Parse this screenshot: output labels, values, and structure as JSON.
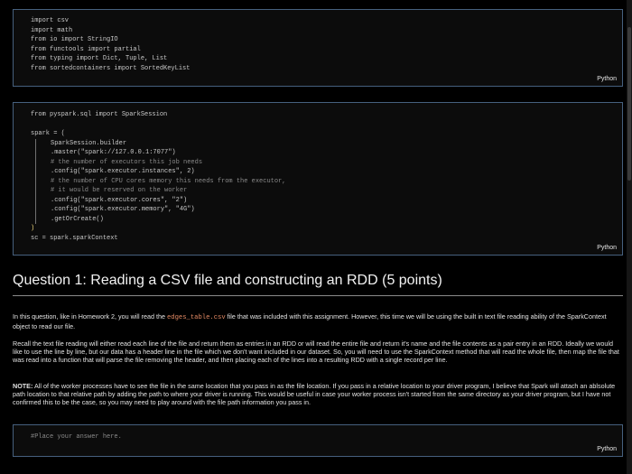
{
  "cells": {
    "imports": {
      "lines": [
        "import csv",
        "import math",
        "from io import StringIO",
        "from functools import partial",
        "from typing import Dict, Tuple, List",
        "from sortedcontainers import SortedKeyList"
      ],
      "language": "Python"
    },
    "spark": {
      "import_line": "from pyspark.sql import SparkSession",
      "spark_open": "spark = (",
      "block_lines": [
        "SparkSession.builder",
        ".master(\"spark://127.0.0.1:7077\")",
        "# the number of executors this job needs",
        ".config(\"spark.executor.instances\", 2)",
        "# the number of CPU cores memory this needs from the executor,",
        "# it would be reserved on the worker",
        ".config(\"spark.executor.cores\", \"2\")",
        ".config(\"spark.executor.memory\", \"4G\")",
        ".getOrCreate()"
      ],
      "spark_close": ")",
      "sc_line": "sc = spark.sparkContext",
      "language": "Python"
    },
    "answer": {
      "placeholder": "#Place your answer here.",
      "language": "Python"
    }
  },
  "question": {
    "title": "Question 1: Reading a CSV file and constructing an RDD (5 points)",
    "p1_before": "In this question, like in Homework 2, you will read the ",
    "p1_code": "edges_table.csv",
    "p1_after": " file that was included with this assignment. However, this time we will be using the built in text file reading ability of the SparkContext object to read our file.",
    "p2": "Recall the text file reading will either read each line of the file and return them as entries in an RDD or will read the entire file and return it's name and the file contents as a pair entry in an RDD. Ideally we would like to use the line by line, but our data has a header line in the file which we don't want included in our dataset. So, you will need to use the SparkContext method that will read the whole file, then map the file that was read into a function that will parse the file removing the header, and then placing each of the lines into a resulting RDD with a single record per line.",
    "note_label": "NOTE:",
    "note_text": " All of the worker processes have to see the file in the same location that you pass in as the file location. If you pass in a relative location to your driver program, I believe that Spark will attach an ablsolute path location to that relative path by adding the path to where your driver is running. This would be useful in case your worker process isn't started from the same directory as your driver program, but I have not confirmed this to be the case, so you may need to play around with the file path information you pass in."
  }
}
